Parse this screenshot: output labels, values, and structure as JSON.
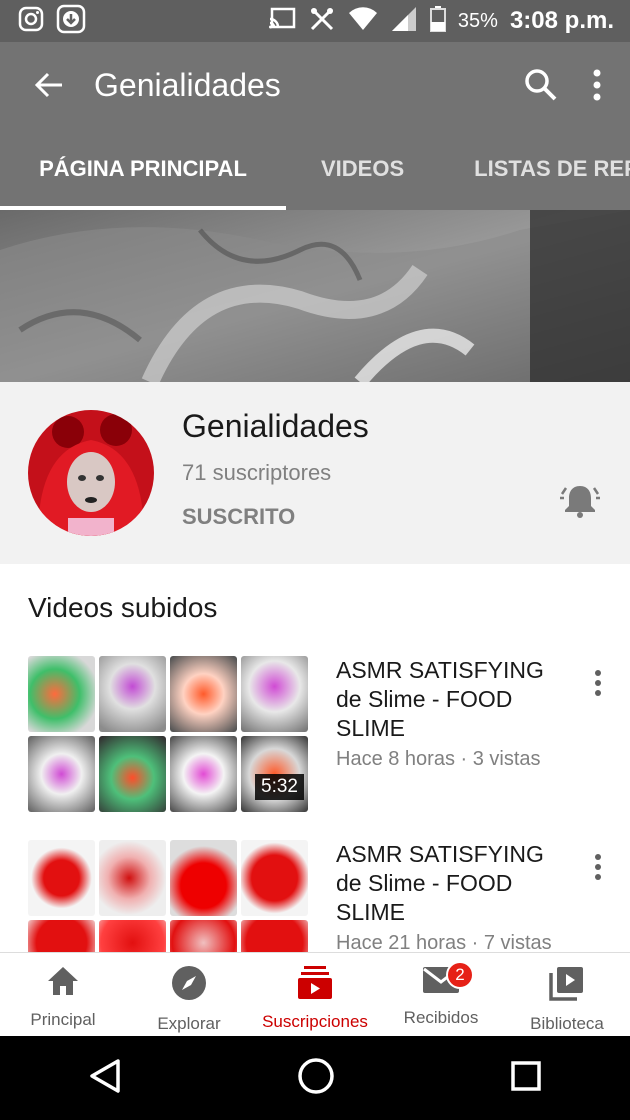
{
  "status_bar": {
    "left_icons": [
      "instagram-icon",
      "download-icon"
    ],
    "right_icons": [
      "cast-icon",
      "tools-icon",
      "wifi-icon",
      "signal-icon",
      "battery-icon"
    ],
    "battery": "35%",
    "time": "3:08 p.m."
  },
  "app_bar": {
    "title": "Genialidades",
    "back_icon": "back-arrow-icon",
    "search_icon": "search-icon",
    "more_icon": "more-vert-icon"
  },
  "tabs": [
    {
      "label": "PÁGINA PRINCIPAL",
      "active": true
    },
    {
      "label": "VIDEOS",
      "active": false
    },
    {
      "label": "LISTAS DE REPRODUCCIÓN",
      "active": false
    }
  ],
  "channel": {
    "name": "Genialidades",
    "subscribers": "71 suscriptores",
    "status": "SUSCRITO",
    "bell_icon": "notification-bell-icon"
  },
  "section_title": "Videos subidos",
  "videos": [
    {
      "title": "ASMR SATISFYING de Slime - FOOD SLIME",
      "meta": "Hace 8 horas · 3 vistas",
      "duration": "5:32"
    },
    {
      "title": "ASMR SATISFYING de Slime - FOOD SLIME",
      "meta": "Hace 21 horas · 7 vistas",
      "duration": ""
    }
  ],
  "bottom_nav": [
    {
      "label": "Principal",
      "icon": "home-icon"
    },
    {
      "label": "Explorar",
      "icon": "explore-icon"
    },
    {
      "label": "Suscripciones",
      "icon": "subscriptions-icon",
      "active": true
    },
    {
      "label": "Recibidos",
      "icon": "inbox-icon",
      "badge": "2"
    },
    {
      "label": "Biblioteca",
      "icon": "library-icon"
    }
  ],
  "colors": {
    "app_bar": "#737373",
    "status_bar": "#5f5f5f",
    "accent": "#cc0000",
    "badge": "#e62117"
  }
}
